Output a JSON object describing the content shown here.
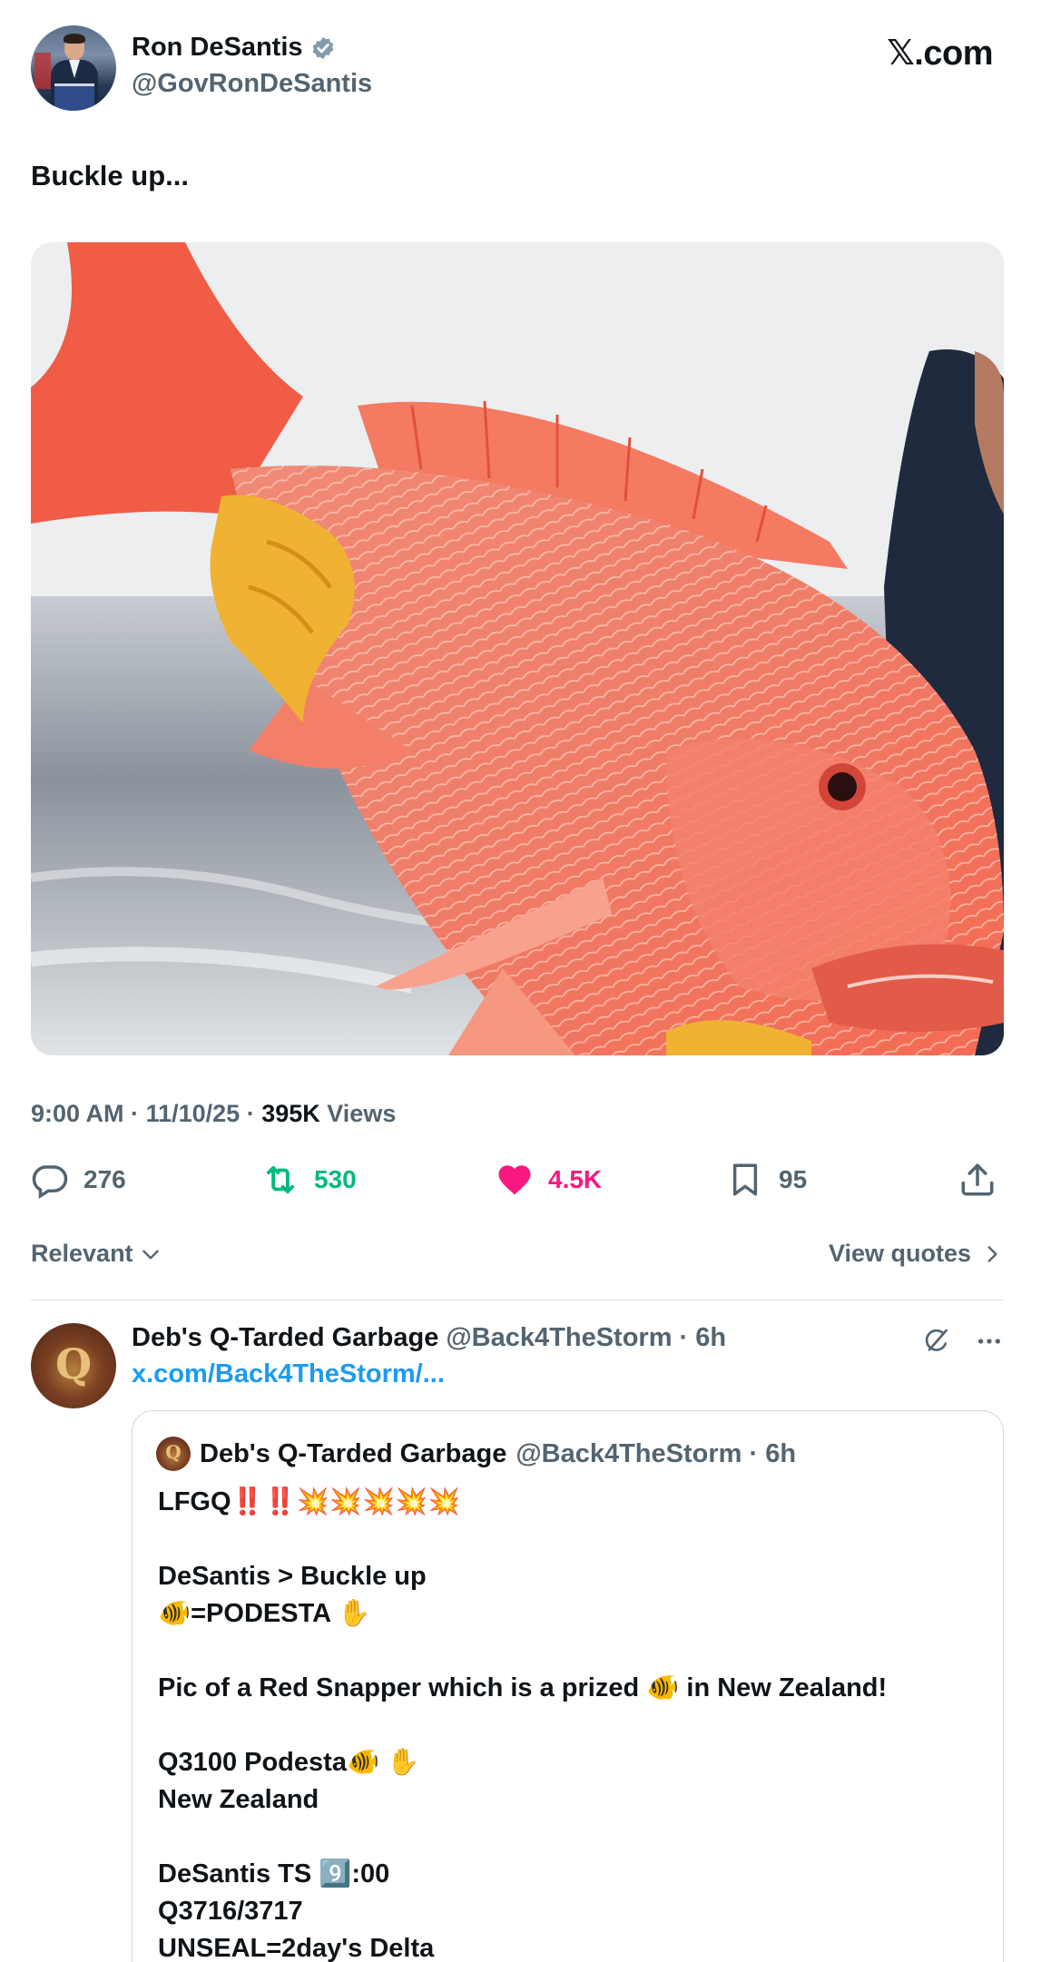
{
  "author": {
    "display_name": "Ron DeSantis",
    "handle": "@GovRonDeSantis",
    "verified": true
  },
  "brand": "𝕏.com",
  "tweet": {
    "text": "Buckle up...",
    "media_alt": "Person holding a large red snapper fish over the sea",
    "time": "9:00 AM",
    "date": "11/10/25",
    "views_count": "395K",
    "views_label": "Views"
  },
  "actions": {
    "replies": "276",
    "reposts": "530",
    "likes": "4.5K",
    "bookmarks": "95"
  },
  "colors": {
    "repost": "#00ba7c",
    "like": "#f91880",
    "link": "#1d9bf0",
    "secondary_text": "#536471"
  },
  "sort": {
    "relevant_label": "Relevant",
    "view_quotes_label": "View quotes"
  },
  "reply": {
    "display_name": "Deb's Q-Tarded Garbage",
    "handle": "@Back4TheStorm",
    "time": "6h",
    "link_text": "x.com/Back4TheStorm/...",
    "quote": {
      "display_name": "Deb's Q-Tarded Garbage",
      "handle": "@Back4TheStorm",
      "time": "6h",
      "lines": [
        "LFGQ‼️‼️💥💥💥💥💥",
        "",
        "DeSantis > Buckle up",
        "🐠=PODESTA ✋",
        "",
        "Pic of a Red Snapper which is a prized 🐠 in New Zealand!",
        "",
        "Q3100 Podesta🐠 ✋",
        "New Zealand",
        "",
        "DeSantis TS 9️⃣:00",
        "Q3716/3717",
        "UNSEAL=2day's Delta"
      ]
    }
  }
}
